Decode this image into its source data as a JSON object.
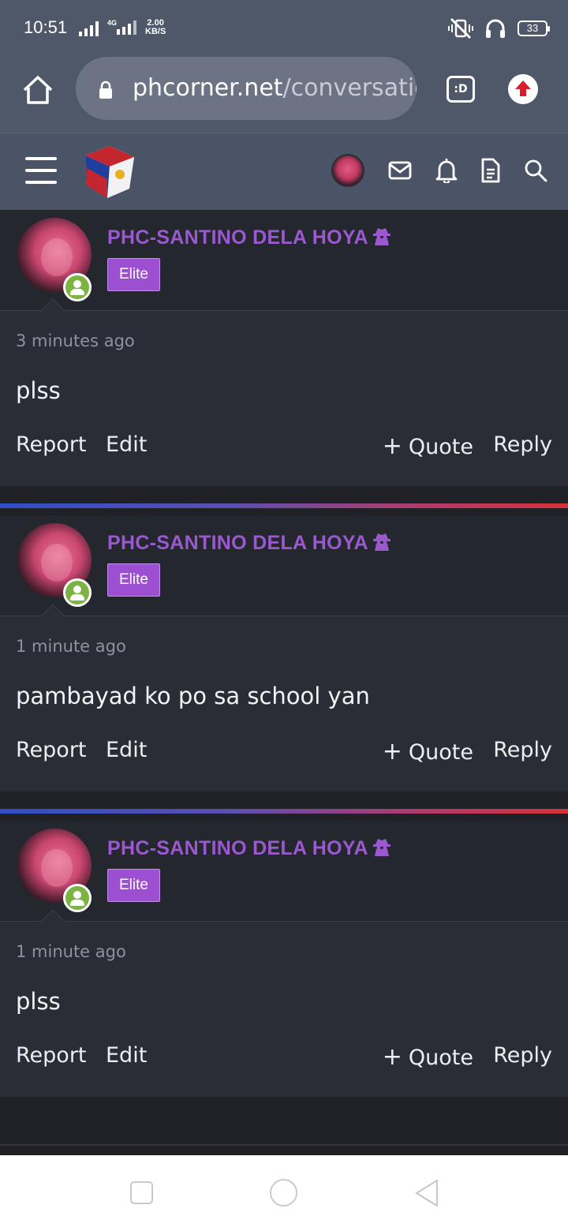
{
  "status_bar": {
    "time": "10:51",
    "network": "4G",
    "speed_value": "2.00",
    "speed_unit": "KB/S",
    "battery": "33"
  },
  "browser": {
    "url_host": "phcorner.net",
    "url_path": "/conversations",
    "tabs_label": ":D"
  },
  "posts": [
    {
      "username": "PHC-SANTINO DELA HOYA",
      "badge": "Elite",
      "time": "3 minutes ago",
      "message": "plss",
      "actions": {
        "report": "Report",
        "edit": "Edit",
        "quote": "Quote",
        "reply": "Reply"
      }
    },
    {
      "username": "PHC-SANTINO DELA HOYA",
      "badge": "Elite",
      "time": "1 minute ago",
      "message": "pambayad ko po sa school yan",
      "actions": {
        "report": "Report",
        "edit": "Edit",
        "quote": "Quote",
        "reply": "Reply"
      }
    },
    {
      "username": "PHC-SANTINO DELA HOYA",
      "badge": "Elite",
      "time": "1 minute ago",
      "message": "plss",
      "actions": {
        "report": "Report",
        "edit": "Edit",
        "quote": "Quote",
        "reply": "Reply"
      }
    }
  ],
  "colors": {
    "username": "#9b59d0",
    "badge": "#9c4fd0",
    "online": "#7cb342",
    "divider_start": "#2f4fc8",
    "divider_end": "#d63138"
  },
  "icons": [
    "home-icon",
    "lock-icon",
    "tabs-icon",
    "upload-icon",
    "menu-icon",
    "logo",
    "mail-icon",
    "bell-icon",
    "document-icon",
    "search-icon",
    "spy-icon",
    "online-status-icon",
    "plus-icon",
    "recents-icon",
    "home-nav-icon",
    "back-icon"
  ]
}
